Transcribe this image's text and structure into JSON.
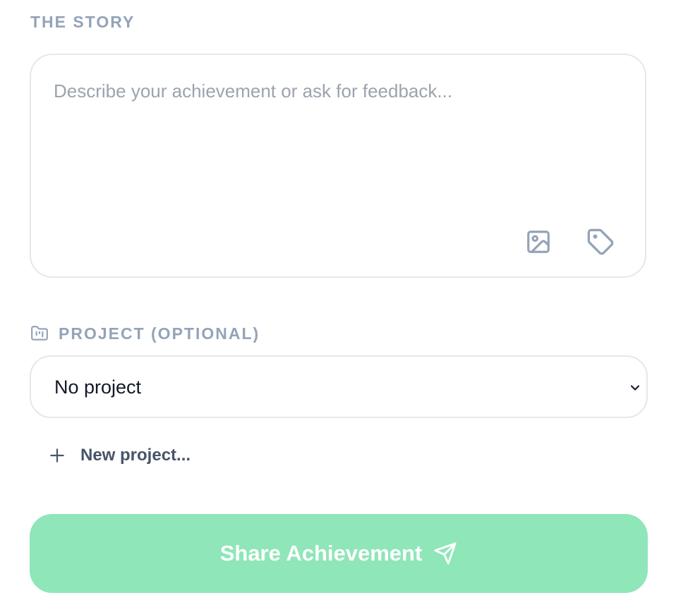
{
  "story": {
    "label": "THE STORY",
    "placeholder": "Describe your achievement or ask for feedback...",
    "value": "",
    "icons": [
      "image-icon",
      "tag-icon"
    ]
  },
  "project": {
    "label": "PROJECT (OPTIONAL)",
    "label_icon": "folder-kanban-icon",
    "selected": "No project",
    "new_label": "New project..."
  },
  "submit": {
    "label": "Share Achievement",
    "icon": "send-icon",
    "state": "disabled"
  },
  "colors": {
    "muted_label": "#94a3b8",
    "border": "#e5e7eb",
    "icon": "#94a3b8",
    "button_bg_disabled": "#8fe6b8",
    "button_text": "#ffffff"
  }
}
